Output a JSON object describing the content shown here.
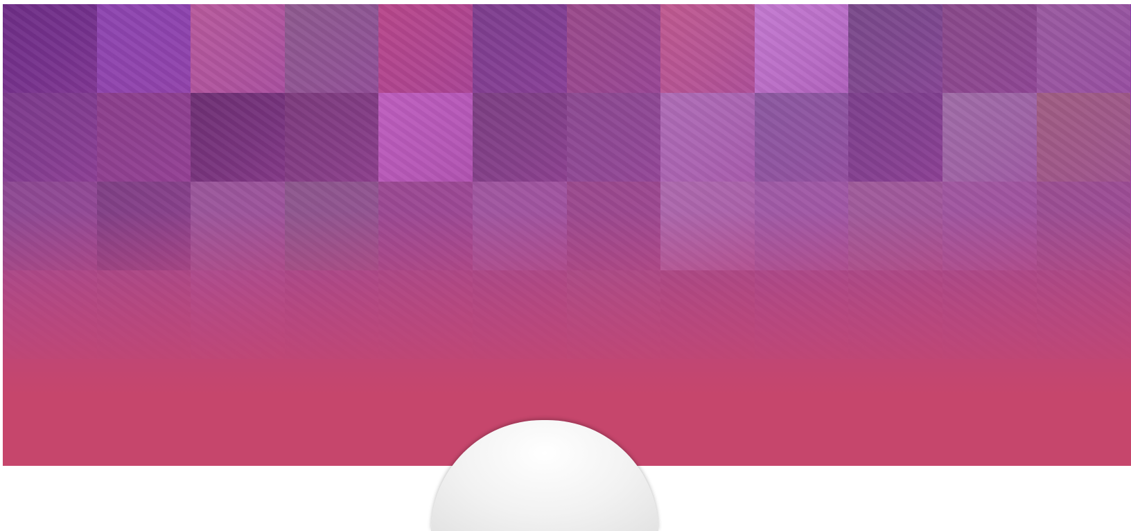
{
  "hero": {
    "gradient_top": "#8a3ba8",
    "gradient_bottom": "#c6466c"
  },
  "mosaic": {
    "columns": 12,
    "rows": 4,
    "tile_colors": [
      "#6e2e86",
      "#8e45b0",
      "#b85a9c",
      "#8f5a8f",
      "#b8478a",
      "#7e3e8e",
      "#9a4a8a",
      "#c05a90",
      "#c47ad0",
      "#7a4a8a",
      "#8a4a8a",
      "#9a5aa0",
      "#7a3a8a",
      "#8a3e8a",
      "#6a2e70",
      "#7a3a7a",
      "#c060c0",
      "#7a3e80",
      "#8a4a90",
      "#b070b8",
      "#8a5aa0",
      "#7a3e8a",
      "#a070a8",
      "#a06080",
      "#8a4a90",
      "#7a3e80",
      "#9a5a9a",
      "#8a5a8a",
      "#9a4a90",
      "#a05aa0",
      "#9a4a8a",
      "#b070b0",
      "#a060a8",
      "#a0609a",
      "#a05aa0",
      "#9a5090",
      "#a04a90",
      "#a04a8c",
      "#a4509a",
      "#a04a90",
      "#a24a8c",
      "#a04a8c",
      "#a0508c",
      "#a04a88",
      "#a04a90",
      "#a04a8c",
      "#a04a8e",
      "#a04a8c"
    ]
  },
  "dome": {
    "color": "#f2f2f2"
  }
}
